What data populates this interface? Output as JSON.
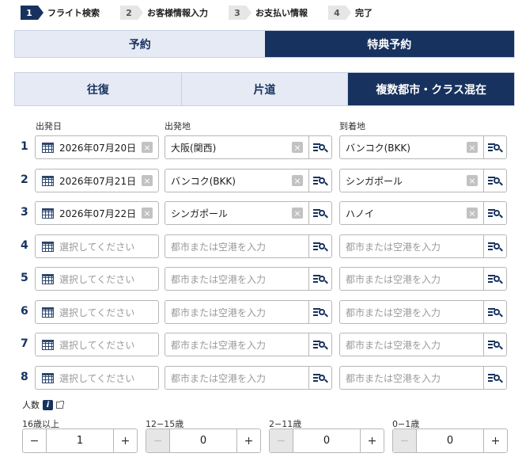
{
  "steps": [
    {
      "num": "1",
      "label": "フライト検索"
    },
    {
      "num": "2",
      "label": "お客様情報入力"
    },
    {
      "num": "3",
      "label": "お支払い情報"
    },
    {
      "num": "4",
      "label": "完了"
    }
  ],
  "booking_tabs": {
    "reserve": "予約",
    "award": "特典予約"
  },
  "trip_tabs": {
    "roundtrip": "往復",
    "oneway": "片道",
    "multicity": "複数都市・クラス混在"
  },
  "columns": {
    "date": "出発日",
    "origin": "出発地",
    "destination": "到着地"
  },
  "placeholders": {
    "date": "選択してください",
    "city": "都市または空港を入力"
  },
  "clear_glyph": "×",
  "rows": [
    {
      "num": "1",
      "date": "2026年07月20日",
      "origin": "大阪(関西)",
      "destination": "バンコク(BKK)"
    },
    {
      "num": "2",
      "date": "2026年07月21日",
      "origin": "バンコク(BKK)",
      "destination": "シンガポール"
    },
    {
      "num": "3",
      "date": "2026年07月22日",
      "origin": "シンガポール",
      "destination": "ハノイ"
    },
    {
      "num": "4",
      "date": "",
      "origin": "",
      "destination": ""
    },
    {
      "num": "5",
      "date": "",
      "origin": "",
      "destination": ""
    },
    {
      "num": "6",
      "date": "",
      "origin": "",
      "destination": ""
    },
    {
      "num": "7",
      "date": "",
      "origin": "",
      "destination": ""
    },
    {
      "num": "8",
      "date": "",
      "origin": "",
      "destination": ""
    }
  ],
  "passengers": {
    "title": "人数",
    "info_glyph": "i",
    "minus": "−",
    "plus": "+",
    "groups": [
      {
        "label": "16歳以上",
        "value": "1",
        "minus_disabled": false
      },
      {
        "label": "12−15歳",
        "value": "0",
        "minus_disabled": true
      },
      {
        "label": "2−11歳",
        "value": "0",
        "minus_disabled": true
      },
      {
        "label": "0−1歳",
        "value": "0",
        "minus_disabled": true
      }
    ]
  },
  "colors": {
    "navy": "#17325e",
    "tab_bg": "#e6eaf5",
    "disabled": "#e6e6e6"
  },
  "icons": {
    "calendar": "calendar-icon",
    "clear": "clear-icon",
    "list_search": "list-search-icon",
    "info": "info-icon",
    "external": "external-link-icon"
  }
}
